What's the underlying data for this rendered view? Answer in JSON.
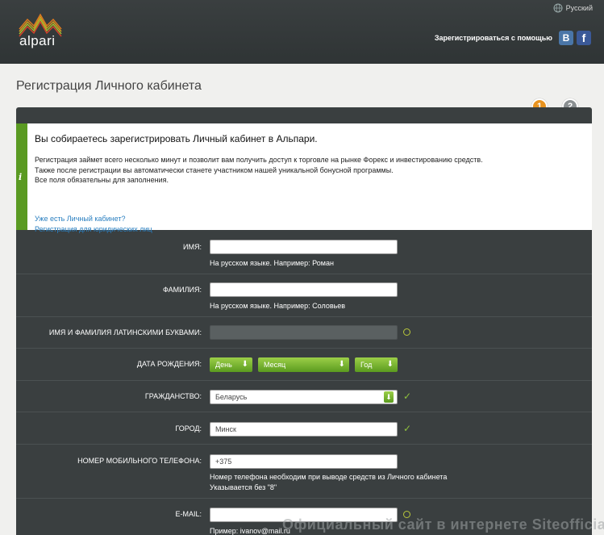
{
  "header": {
    "logo_text": "alpari",
    "language": "Русский",
    "social_label": "Зарегистрироваться с помощью",
    "vk": "B",
    "fb": "f"
  },
  "page_title": "Регистрация Личного кабинета",
  "steps": [
    "1",
    "2"
  ],
  "intro": {
    "icon": "i",
    "heading": "Вы собираетесь зарегистрировать Личный кабинет в Альпари.",
    "line1": "Регистрация займет всего несколько минут и позволит вам получить доступ к торговле на рынке Форекс и инвестированию средств.",
    "line2": "Также после регистрации вы автоматически станете участником нашей уникальной бонусной программы.",
    "line3": "Все поля обязательны для заполнения.",
    "link_login": "Уже есть Личный кабинет?",
    "link_legal": "Регистрация для юридических лиц"
  },
  "form": {
    "name_label": "ИМЯ:",
    "name_hint": "На русском языке. Например: Роман",
    "surname_label": "ФАМИЛИЯ:",
    "surname_hint": "На русском языке. Например: Соловьев",
    "latin_label": "ИМЯ И ФАМИЛИЯ ЛАТИНСКИМИ БУКВАМИ:",
    "birth_label": "ДАТА РОЖДЕНИЯ:",
    "day": "День",
    "month": "Месяц",
    "year": "Год",
    "citizenship_label": "ГРАЖДАНСТВО:",
    "citizenship_value": "Беларусь",
    "city_label": "ГОРОД:",
    "city_value": "Минск",
    "phone_label": "НОМЕР МОБИЛЬНОГО ТЕЛЕФОНА:",
    "phone_value": "+375",
    "phone_hint1": "Номер телефона необходим при выводе средств из Личного кабинета",
    "phone_hint2": "Указывается без \"8\"",
    "email_label": "E-MAIL:",
    "email_hint": "Пример: ivanov@mail.ru"
  },
  "watermark": "Официальный сайт в интернете Siteofficial.ru"
}
